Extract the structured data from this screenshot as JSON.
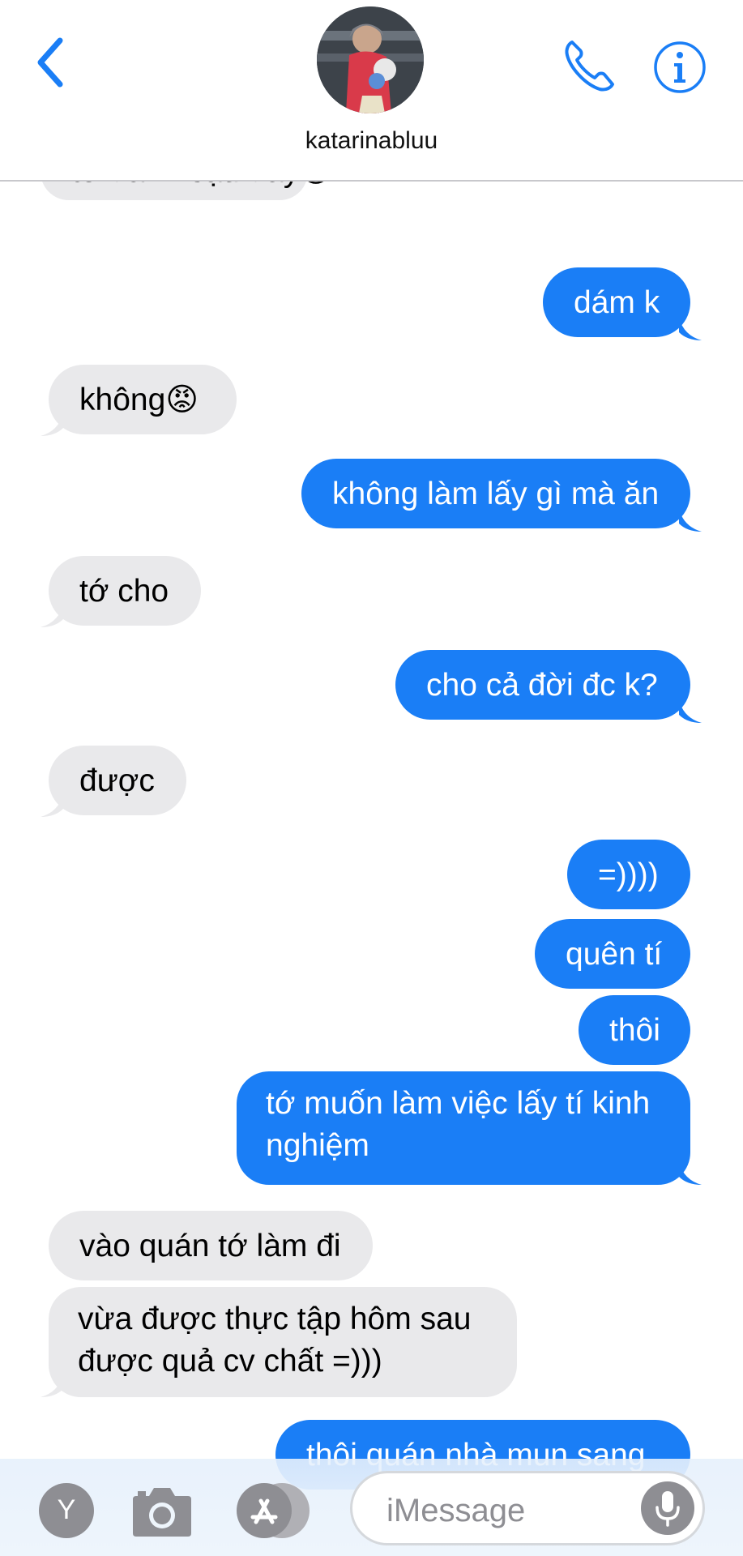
{
  "header": {
    "contact_name": "katarinabluu"
  },
  "messages": [
    {
      "text": "tớ đánh cậu đấy😡",
      "side": "in"
    },
    {
      "text": "dám k",
      "side": "out"
    },
    {
      "text": "không😡",
      "side": "in"
    },
    {
      "text": "không làm lấy gì mà ăn",
      "side": "out"
    },
    {
      "text": "tớ cho",
      "side": "in"
    },
    {
      "text": "cho cả đời đc k?",
      "side": "out"
    },
    {
      "text": "được",
      "side": "in"
    },
    {
      "text": "=))))",
      "side": "out"
    },
    {
      "text": "quên tí",
      "side": "out"
    },
    {
      "text": "thôi",
      "side": "out"
    },
    {
      "text": "tớ muốn làm việc lấy tí kinh nghiệm",
      "side": "out"
    },
    {
      "text": "vào quán tớ làm đi",
      "side": "in"
    },
    {
      "text": "vừa được thực tập hôm sau được quả cv chất =)))",
      "side": "in"
    },
    {
      "text": "thôi quán nhà mun sang",
      "side": "out"
    }
  ],
  "composer": {
    "placeholder": "iMessage",
    "apps": [
      "Y"
    ]
  },
  "colors": {
    "accent": "#1a7ef6",
    "incoming_bubble": "#e9e9eb",
    "outgoing_bubble": "#1a7ef6"
  },
  "icons": [
    "back-chevron-icon",
    "phone-icon",
    "info-icon",
    "camera-icon",
    "app-store-icon",
    "microphone-icon"
  ]
}
